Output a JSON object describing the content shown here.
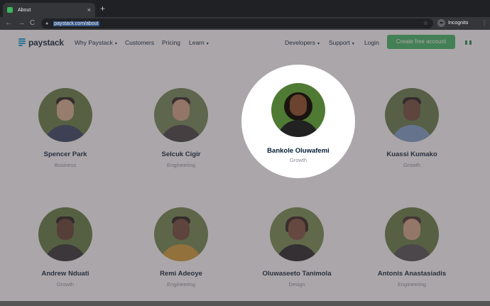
{
  "browser": {
    "tab_title": "About",
    "tab_close": "×",
    "new_tab": "+",
    "back": "←",
    "forward": "→",
    "reload": "C",
    "url": "paystack.com/about",
    "star": "☆",
    "incognito_label": "Incognito",
    "menu": "⋮"
  },
  "navbar": {
    "logo": "paystack",
    "links": {
      "why": "Why Paystack",
      "customers": "Customers",
      "pricing": "Pricing",
      "learn": "Learn",
      "developers": "Developers",
      "support": "Support",
      "login": "Login"
    },
    "cta": "Create free account",
    "caret": "▾"
  },
  "team": [
    {
      "name": "Spencer Park",
      "role": "Business"
    },
    {
      "name": "Selcuk Cigir",
      "role": "Engineering"
    },
    {
      "name": "Bankole Oluwafemi",
      "role": "Growth"
    },
    {
      "name": "Kuassi Kumako",
      "role": "Growth"
    },
    {
      "name": "Andrew Nduati",
      "role": "Growth"
    },
    {
      "name": "Remi Adeoye",
      "role": "Engineering"
    },
    {
      "name": "Oluwaseeto Tanimola",
      "role": "Design"
    },
    {
      "name": "Antonis Anastasiadis",
      "role": "Engineering"
    }
  ],
  "colors": {
    "brand_dark": "#011b33",
    "brand_blue": "#0ba4db",
    "cta_green": "#3bb75e"
  }
}
